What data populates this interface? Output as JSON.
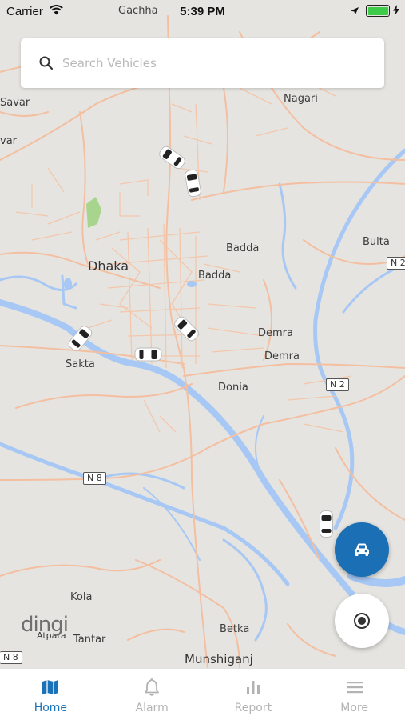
{
  "status_bar": {
    "carrier": "Carrier",
    "time": "5:39 PM"
  },
  "search": {
    "placeholder": "Search Vehicles"
  },
  "map": {
    "labels": {
      "gachha": "Gachha",
      "savar": "Savar",
      "var": "var",
      "nagari": "Nagari",
      "dhaka": "Dhaka",
      "badda_1": "Badda",
      "badda_2": "Badda",
      "bulta": "Bulta",
      "demra_1": "Demra",
      "demra_2": "Demra",
      "sakta": "Sakta",
      "donia": "Donia",
      "kola": "Kola",
      "atpara": "Atpara",
      "tantar": "Tantar",
      "betka": "Betka",
      "munshiganj": "Munshiganj"
    },
    "shields": {
      "n2_top": "N 2",
      "n2_mid": "N 2",
      "n8_mid": "N 8",
      "n8_bottom": "N 8"
    },
    "watermark": "dingi",
    "vehicle_count": 7
  },
  "tabs": [
    {
      "label": "Home",
      "icon": "map-icon",
      "active": true
    },
    {
      "label": "Alarm",
      "icon": "bell-icon",
      "active": false
    },
    {
      "label": "Report",
      "icon": "bar-chart-icon",
      "active": false
    },
    {
      "label": "More",
      "icon": "menu-icon",
      "active": false
    }
  ],
  "colors": {
    "accent": "#1a73b8",
    "fab": "#1a6fb5",
    "road": "#f5c6a8",
    "water": "#a7c8f5",
    "battery": "#3ecb49"
  }
}
